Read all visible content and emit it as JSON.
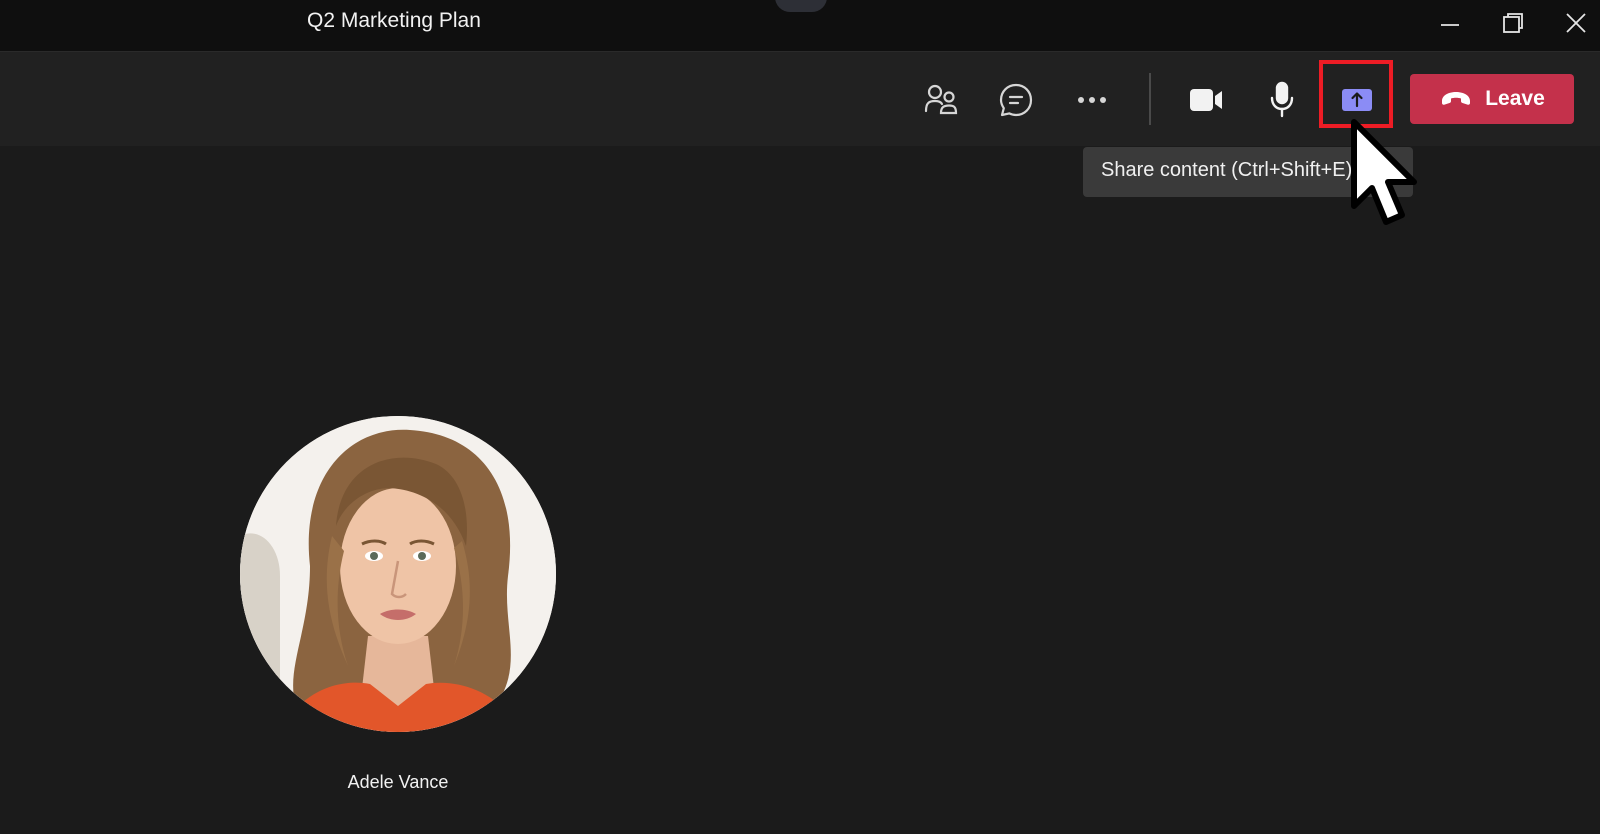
{
  "window": {
    "title": "Q2 Marketing Plan",
    "controls": [
      "minimize-icon",
      "restore-icon",
      "close-icon"
    ]
  },
  "toolbar": {
    "icons": [
      "people-icon",
      "chat-icon",
      "more-options-icon",
      "camera-icon",
      "microphone-icon",
      "share-content-icon",
      "phone-hangup-icon"
    ],
    "leave_label": "Leave",
    "share_highlighted": true,
    "colors": {
      "leave": "#c4314b",
      "share_icon": "#8b8cf5",
      "highlight": "#ee1c25"
    }
  },
  "tooltip": {
    "text": "Share content (Ctrl+Shift+E)"
  },
  "participant": {
    "name": "Adele Vance"
  }
}
